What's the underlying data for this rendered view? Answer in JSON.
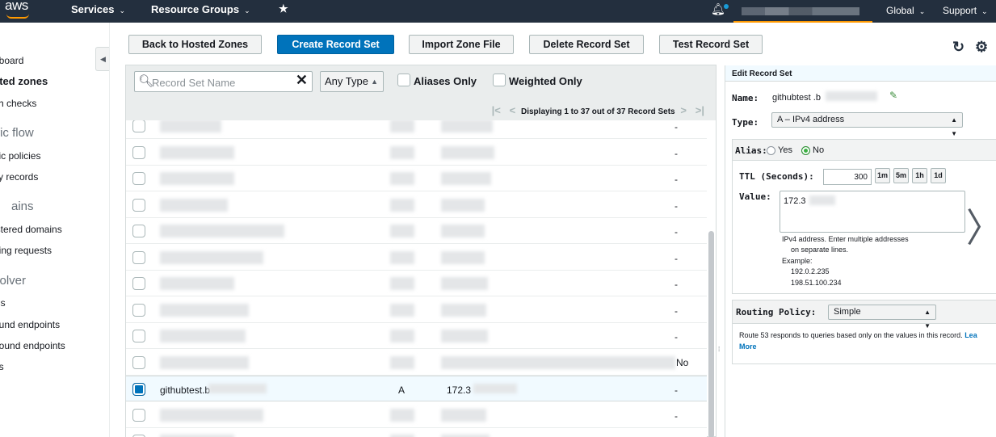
{
  "topnav": {
    "logo": "aws",
    "services": "Services",
    "resource_groups": "Resource Groups",
    "pin_icon": "pin-icon",
    "region": "Global",
    "support": "Support",
    "caret": "⌄"
  },
  "sidebar": {
    "collapse": "◀",
    "items": [
      {
        "label": "hboard",
        "style": "normal"
      },
      {
        "label": "sted zones",
        "style": "bold"
      },
      {
        "label": "lth checks",
        "style": "normal"
      },
      {
        "label": "ffic flow",
        "style": "head"
      },
      {
        "label": "ffic policies",
        "style": "normal"
      },
      {
        "label": "cy records",
        "style": "normal"
      },
      {
        "label": "ains",
        "style": "head"
      },
      {
        "label": "istered domains",
        "style": "normal"
      },
      {
        "label": "ding requests",
        "style": "normal"
      },
      {
        "label": "solver",
        "style": "head"
      },
      {
        "label": "Cs",
        "style": "normal"
      },
      {
        "label": "ound endpoints",
        "style": "normal"
      },
      {
        "label": "bound endpoints",
        "style": "normal"
      },
      {
        "label": "es",
        "style": "normal"
      }
    ]
  },
  "toolbar": {
    "back": "Back to Hosted Zones",
    "create": "Create Record Set",
    "import": "Import Zone File",
    "delete": "Delete Record Set",
    "test": "Test Record Set",
    "refresh_icon": "↻",
    "settings_icon": "⚙"
  },
  "filter": {
    "search_placeholder": "Record Set Name",
    "type_select": "Any Type",
    "aliases_only": "Aliases Only",
    "weighted_only": "Weighted Only",
    "pager_text": "Displaying 1 to 37 out of 37 Record Sets"
  },
  "rows": [
    {
      "name": "",
      "type": "",
      "value": "",
      "last": "-",
      "selected": false
    },
    {
      "name": "",
      "type": "",
      "value": "",
      "last": "-",
      "selected": false
    },
    {
      "name": "",
      "type": "",
      "value": "",
      "last": "-",
      "selected": false
    },
    {
      "name": "",
      "type": "",
      "value": "",
      "last": "-",
      "selected": false
    },
    {
      "name": "",
      "type": "",
      "value": "",
      "last": "-",
      "selected": false
    },
    {
      "name": "",
      "type": "",
      "value": "",
      "last": "-",
      "selected": false
    },
    {
      "name": "",
      "type": "",
      "value": "",
      "last": "-",
      "selected": false
    },
    {
      "name": "",
      "type": "",
      "value": "",
      "last": "-",
      "selected": false
    },
    {
      "name": "",
      "type": "",
      "value": "",
      "last": "-",
      "selected": false
    },
    {
      "name": "",
      "type": "",
      "value": "",
      "last": "No",
      "selected": false
    },
    {
      "name": "githubtest.b",
      "type": "A",
      "value": "172.3",
      "last": "-",
      "selected": true
    },
    {
      "name": "",
      "type": "",
      "value": "",
      "last": "-",
      "selected": false
    },
    {
      "name": "",
      "type": "",
      "value": "",
      "last": "-",
      "selected": false
    }
  ],
  "panel": {
    "title": "Edit Record Set",
    "name_label": "Name:",
    "name_value": "githubtest .b",
    "type_label": "Type:",
    "type_value": "A – IPv4 address",
    "alias_label": "Alias:",
    "alias_yes": "Yes",
    "alias_no": "No",
    "ttl_label": "TTL (Seconds):",
    "ttl_value": "300",
    "ttl_buttons": [
      "1m",
      "5m",
      "1h",
      "1d"
    ],
    "value_label": "Value:",
    "value_text": "172.3",
    "help_lines": [
      "IPv4 address. Enter multiple addresses",
      "on separate lines.",
      "Example:",
      "192.0.2.235",
      "198.51.100.234"
    ],
    "routing_label": "Routing Policy:",
    "routing_value": "Simple",
    "routing_help": "Route 53 responds to queries based only on the values in this record.",
    "learn": "Lea",
    "more": "More"
  }
}
